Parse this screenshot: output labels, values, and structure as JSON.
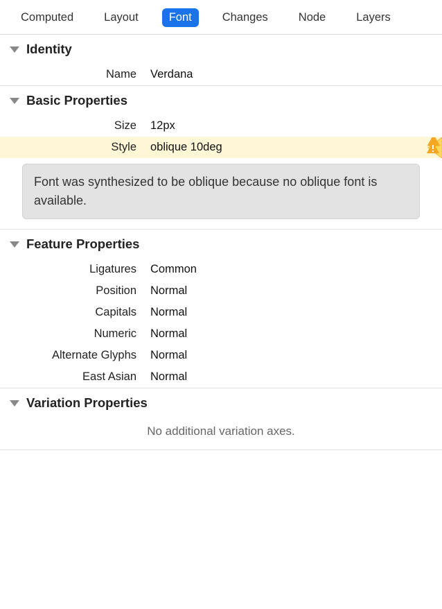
{
  "tabs": {
    "computed": "Computed",
    "layout": "Layout",
    "font": "Font",
    "changes": "Changes",
    "node": "Node",
    "layers": "Layers"
  },
  "identity": {
    "title": "Identity",
    "name_label": "Name",
    "name_value": "Verdana"
  },
  "basic": {
    "title": "Basic Properties",
    "size_label": "Size",
    "size_value": "12px",
    "style_label": "Style",
    "style_value": "oblique 10deg",
    "style_warning": "Font was synthesized to be oblique because no oblique font is available."
  },
  "feature": {
    "title": "Feature Properties",
    "ligatures_label": "Ligatures",
    "ligatures_value": "Common",
    "position_label": "Position",
    "position_value": "Normal",
    "capitals_label": "Capitals",
    "capitals_value": "Normal",
    "numeric_label": "Numeric",
    "numeric_value": "Normal",
    "alternate_label": "Alternate Glyphs",
    "alternate_value": "Normal",
    "eastasian_label": "East Asian",
    "eastasian_value": "Normal"
  },
  "variation": {
    "title": "Variation Properties",
    "empty_msg": "No additional variation axes."
  }
}
